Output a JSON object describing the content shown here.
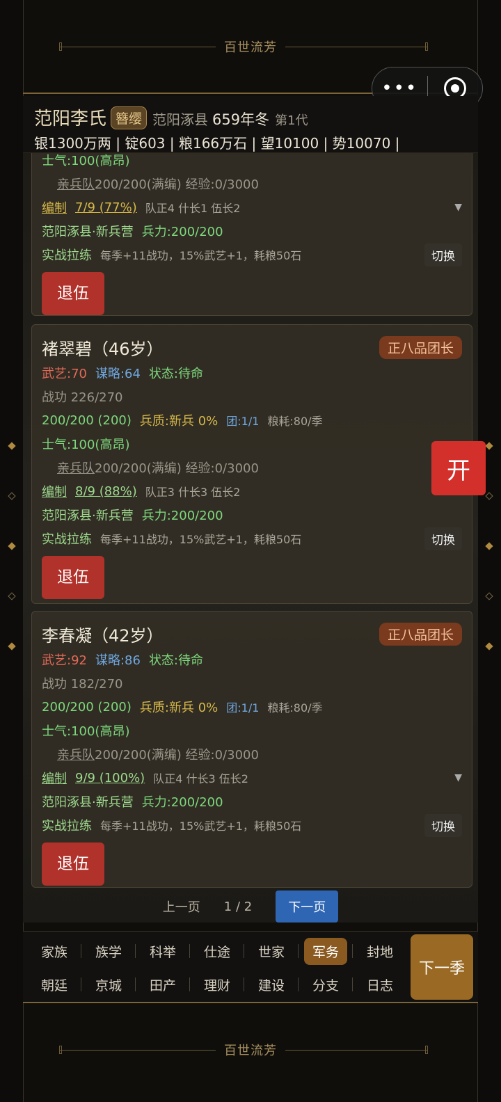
{
  "banner": {
    "title": "百世流芳"
  },
  "capsule": {
    "more": "•••"
  },
  "header": {
    "clan": "范阳李氏",
    "badge": "簪缨",
    "place": "范阳涿县",
    "year": "659年冬",
    "generation": "第1代",
    "stats": "银1300万两 | 锭603 | 粮166万石 | 望10100 | 势10070 |"
  },
  "cards": [
    {
      "morale": "士气:100(高昂)",
      "guard_label": "亲兵队",
      "guard_value": "200/200(满编) 经验:0/3000",
      "org_label": "编制",
      "org_value": "7/9 (77%)",
      "org_detail": "队正4 什长1 伍长2",
      "location": "范阳涿县·新兵营",
      "strength": "兵力:200/200",
      "drill_label": "实战拉练",
      "drill_detail": "每季+11战功，15%武艺+1，耗粮50石",
      "switch": "切换",
      "retire": "退伍"
    },
    {
      "name": "褚翠碧（46岁）",
      "rank": "正八品团长",
      "martial": "武艺:70",
      "strategy": "谋略:64",
      "status": "状态:待命",
      "merit": "战功 226/270",
      "troops": "200/200 (200)",
      "quality": "兵质:新兵 0%",
      "regiment": "团:1/1",
      "grain": "粮耗:80/季",
      "morale": "士气:100(高昂)",
      "guard_label": "亲兵队",
      "guard_value": "200/200(满编) 经验:0/3000",
      "org_label": "编制",
      "org_value": "8/9 (88%)",
      "org_detail": "队正3 什长3 伍长2",
      "location": "范阳涿县·新兵营",
      "strength": "兵力:200/200",
      "drill_label": "实战拉练",
      "drill_detail": "每季+11战功，15%武艺+1，耗粮50石",
      "switch": "切换",
      "retire": "退伍"
    },
    {
      "name": "李春凝（42岁）",
      "rank": "正八品团长",
      "martial": "武艺:92",
      "strategy": "谋略:86",
      "status": "状态:待命",
      "merit": "战功 182/270",
      "troops": "200/200 (200)",
      "quality": "兵质:新兵 0%",
      "regiment": "团:1/1",
      "grain": "粮耗:80/季",
      "morale": "士气:100(高昂)",
      "guard_label": "亲兵队",
      "guard_value": "200/200(满编) 经验:0/3000",
      "org_label": "编制",
      "org_value": "9/9 (100%)",
      "org_detail": "队正4 什长3 伍长2",
      "location": "范阳涿县·新兵营",
      "strength": "兵力:200/200",
      "drill_label": "实战拉练",
      "drill_detail": "每季+11战功，15%武艺+1，耗粮50石",
      "switch": "切换",
      "retire": "退伍"
    }
  ],
  "pager": {
    "prev": "上一页",
    "page": "1 / 2",
    "next": "下一页"
  },
  "float_button": "开",
  "nav": {
    "items": [
      "家族",
      "族学",
      "科举",
      "仕途",
      "世家",
      "军务",
      "封地",
      "朝廷",
      "京城",
      "田产",
      "理财",
      "建设",
      "分支",
      "日志"
    ],
    "active": "军务",
    "next_season": "下一季"
  }
}
